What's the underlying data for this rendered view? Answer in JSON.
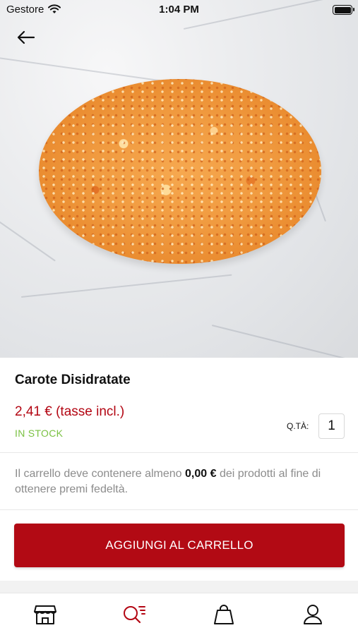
{
  "status_bar": {
    "carrier": "Gestore",
    "time": "1:04 PM"
  },
  "product": {
    "title": "Carote Disidratate",
    "price": "2,41 € (tasse incl.)",
    "stock": "IN STOCK",
    "qty_label": "Q.TÀ:",
    "qty_value": "1"
  },
  "loyalty": {
    "prefix": "Il carrello deve contenere almeno ",
    "amount": "0,00 €",
    "suffix": " dei prodotti al fine di ottenere premi fedeltà."
  },
  "actions": {
    "add_to_cart": "AGGIUNGI AL CARRELLO"
  },
  "tab_bar": {
    "active_color": "#b30613",
    "items": [
      {
        "icon": "store-icon"
      },
      {
        "icon": "search-list-icon",
        "active": true
      },
      {
        "icon": "shopping-bag-icon"
      },
      {
        "icon": "user-icon"
      }
    ]
  },
  "colors": {
    "brand_red": "#b20a14",
    "stock_green": "#7ac142"
  }
}
